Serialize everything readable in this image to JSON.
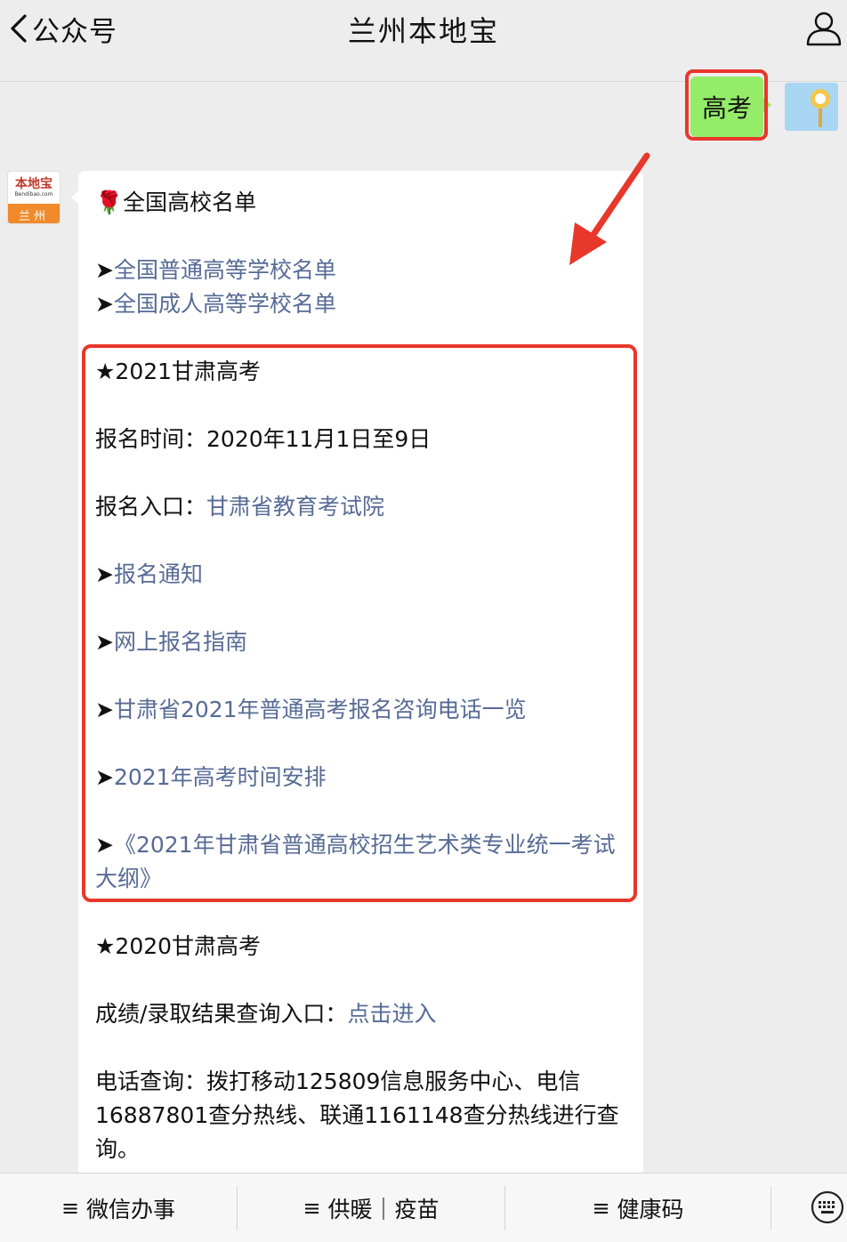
{
  "header": {
    "back_label": "公众号",
    "title": "兰州本地宝"
  },
  "outgoing": {
    "text": "高考"
  },
  "account_avatar": {
    "logo": "本地宝",
    "url": "Bendibao.com",
    "city": "兰州"
  },
  "message": {
    "heading_rose": "🌹",
    "heading": "全国高校名单",
    "link_general": "全国普通高等学校名单",
    "link_adult": "全国成人高等学校名单",
    "section2021_title": "★2021甘肃高考",
    "reg_time_label": "报名时间：",
    "reg_time_value": "2020年11月1日至9日",
    "reg_entry_label": "报名入口：",
    "reg_entry_link": "甘肃省教育考试院",
    "link_notice": "报名通知",
    "link_guide": "网上报名指南",
    "link_phone": "甘肃省2021年普通高考报名咨询电话一览",
    "link_schedule": "2021年高考时间安排",
    "link_art_outline": "《2021年甘肃省普通高校招生艺术类专业统一考试大纲》",
    "section2020_title": "★2020甘肃高考",
    "score_label": "成绩/录取结果查询入口：",
    "score_link": "点击进入",
    "phone_query": "电话查询：拨打移动125809信息服务中心、电信16887801查分热线、联通1161148查分热线进行查询。"
  },
  "bottom_menu": [
    {
      "label": "微信办事"
    },
    {
      "label": "供暖｜疫苗"
    },
    {
      "label": "健康码"
    }
  ],
  "arrow_glyph": "➤",
  "hamburger_glyph": "≡",
  "colors": {
    "link": "#576b95",
    "highlight": "#e8372b",
    "outgoing_bubble": "#95ec69"
  }
}
